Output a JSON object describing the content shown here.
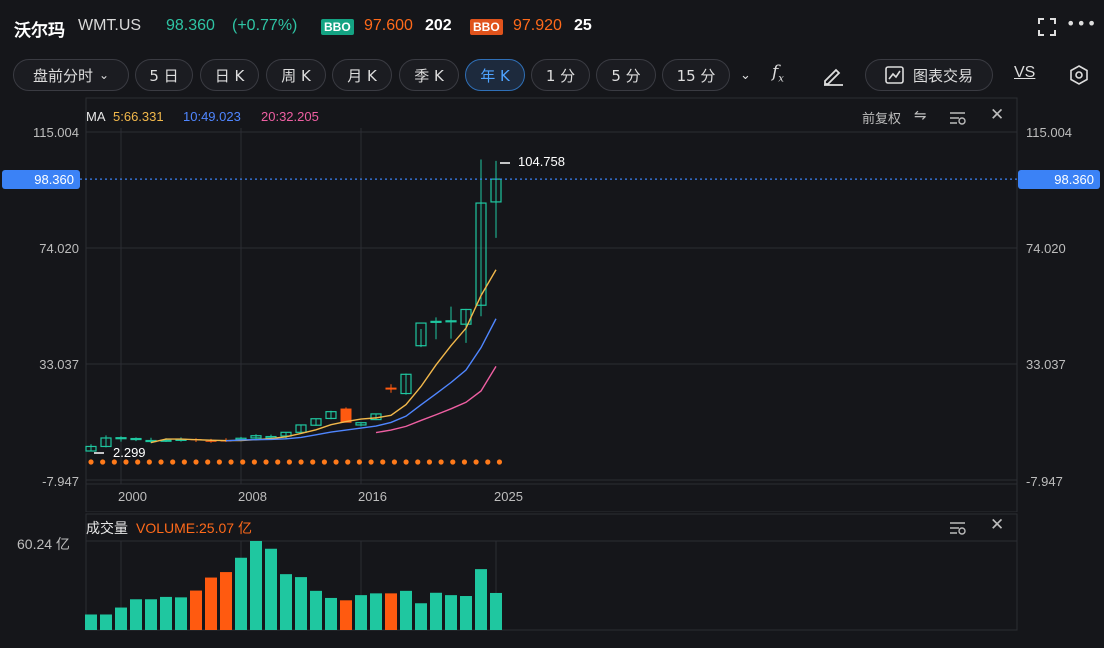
{
  "header": {
    "name": "沃尔玛",
    "ticker": "WMT.US",
    "price": "98.360",
    "change": "(+0.77%)",
    "bbo_label": "BBO",
    "bid_price": "97.600",
    "bid_size": "202",
    "ask_price": "97.920",
    "ask_size": "25"
  },
  "toolbar": {
    "premarket": "盘前分时",
    "buttons": [
      "5 日",
      "日 K",
      "周 K",
      "月 K",
      "季 K",
      "年 K",
      "1 分",
      "5 分",
      "15 分"
    ],
    "active": "年 K",
    "chart_trade": "图表交易",
    "vs": "VS"
  },
  "main_chart": {
    "ma_label": "MA",
    "ma5": "5:66.331",
    "ma10": "10:49.023",
    "ma20": "20:32.205",
    "adjust_label": "前复权",
    "y_ticks": [
      "115.004",
      "74.020",
      "33.037",
      "-7.947"
    ],
    "current_price_box": "98.360",
    "high_label": "104.758",
    "low_label": "2.299",
    "x_ticks": [
      "2000",
      "2008",
      "2016",
      "2025"
    ]
  },
  "volume_chart": {
    "title": "成交量",
    "volume_text": "VOLUME:25.07 亿",
    "y_tick": "60.24 亿"
  },
  "colors": {
    "up": "#1fc7a0",
    "down": "#ff5a10",
    "ma5": "#f2b84b",
    "ma10": "#4f86ff",
    "ma20": "#ee5fa2",
    "price_line": "#3b82f6"
  },
  "chart_data": {
    "type": "candlestick",
    "x": [
      1998,
      1999,
      2000,
      2001,
      2002,
      2003,
      2004,
      2005,
      2006,
      2007,
      2008,
      2009,
      2010,
      2011,
      2012,
      2013,
      2014,
      2015,
      2016,
      2017,
      2018,
      2019,
      2020,
      2021,
      2022,
      2023,
      2024,
      2025
    ],
    "open": [
      2.3,
      3.9,
      6.9,
      6.7,
      6.0,
      6.1,
      6.3,
      6.5,
      5.9,
      6.0,
      6.3,
      6.9,
      6.9,
      7.6,
      8.9,
      11.4,
      13.8,
      17.3,
      11.5,
      13.4,
      24.7,
      22.6,
      39.5,
      48.0,
      48.2,
      47.1,
      53.8,
      90.3
    ],
    "high": [
      4.7,
      7.8,
      7.5,
      7.1,
      7.0,
      6.8,
      7.1,
      6.8,
      6.6,
      6.8,
      7.3,
      8.2,
      8.1,
      9.0,
      11.5,
      13.7,
      16.5,
      17.7,
      12.2,
      15.5,
      25.9,
      29.7,
      45.4,
      49.5,
      53.3,
      52.5,
      105.3,
      104.8
    ],
    "low": [
      2.3,
      3.6,
      5.6,
      5.8,
      5.1,
      5.5,
      5.6,
      5.5,
      5.2,
      5.5,
      5.8,
      6.0,
      6.7,
      6.7,
      8.8,
      11.2,
      13.5,
      12.5,
      11.0,
      13.2,
      22.9,
      22.2,
      39.0,
      41.8,
      42.0,
      40.5,
      49.9,
      77.6
    ],
    "close": [
      3.9,
      6.9,
      7.0,
      6.7,
      6.0,
      6.1,
      6.4,
      6.1,
      5.7,
      5.9,
      6.8,
      7.7,
      7.4,
      8.9,
      11.5,
      13.7,
      16.2,
      12.3,
      12.3,
      15.4,
      24.0,
      29.4,
      47.5,
      48.1,
      48.3,
      52.3,
      89.9,
      98.36
    ],
    "ma5_values": [
      null,
      null,
      null,
      null,
      5.3,
      6.5,
      6.5,
      6.3,
      6.1,
      6.0,
      6.0,
      6.3,
      6.7,
      7.3,
      8.5,
      9.8,
      11.6,
      12.7,
      13.6,
      14.0,
      14.9,
      18.7,
      25.1,
      32.7,
      39.5,
      45.7,
      57.2,
      66.331
    ],
    "ma10_values": [
      null,
      null,
      null,
      null,
      null,
      null,
      null,
      null,
      null,
      5.9,
      6.2,
      6.3,
      6.4,
      6.6,
      7.1,
      8.0,
      9.0,
      9.7,
      10.4,
      11.1,
      12.4,
      14.6,
      18.6,
      22.5,
      26.5,
      30.9,
      38.8,
      49.023
    ],
    "ma20_values": [
      null,
      null,
      null,
      null,
      null,
      null,
      null,
      null,
      null,
      null,
      null,
      null,
      null,
      null,
      null,
      null,
      null,
      null,
      null,
      8.8,
      9.7,
      11.0,
      13.1,
      15.1,
      17.2,
      19.5,
      23.5,
      32.205
    ],
    "volume_yi": [
      10.5,
      10.5,
      15.2,
      20.8,
      20.8,
      22.4,
      22.1,
      26.7,
      35.5,
      39.2,
      48.9,
      60.24,
      55.0,
      37.8,
      35.8,
      26.5,
      21.7,
      20.1,
      23.6,
      24.8,
      24.8,
      26.5,
      18.1,
      25.2,
      23.6,
      23.0,
      41.2,
      25.07
    ],
    "ylim": [
      -7.947,
      115.004
    ],
    "xlabel": "",
    "ylabel": ""
  }
}
